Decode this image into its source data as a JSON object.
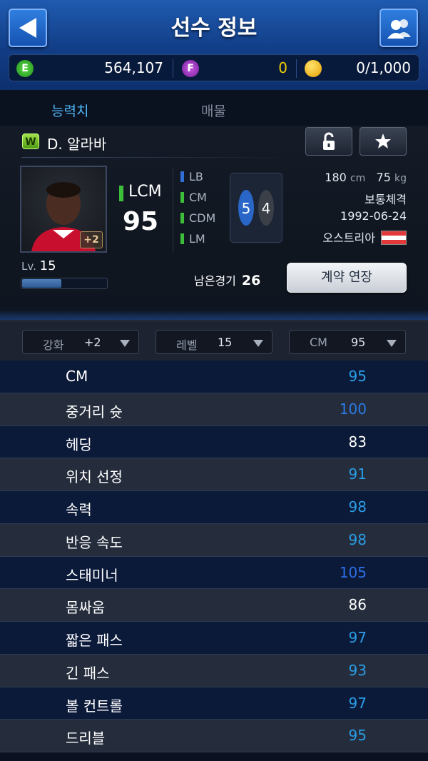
{
  "header": {
    "title": "선수 정보"
  },
  "currency": {
    "e_icon": "E",
    "e_value": "564,107",
    "f_icon": "F",
    "f_value": "0",
    "gold_value": "0/1,000"
  },
  "tabs": [
    {
      "label": "능력치",
      "active": true
    },
    {
      "label": "매물",
      "active": false
    }
  ],
  "player": {
    "badge": "W",
    "name": "D. 알라바",
    "main_position": "LCM",
    "overall": "95",
    "upgrade_badge": "+2",
    "level_label": "Lv.",
    "level": "15",
    "level_progress": 0.47,
    "positions": [
      {
        "label": "LB",
        "color": "#2f6fd6"
      },
      {
        "label": "CM",
        "color": "#3ebd3a"
      },
      {
        "label": "CDM",
        "color": "#3ebd3a"
      },
      {
        "label": "LM",
        "color": "#3ebd3a"
      }
    ],
    "foot_left": "5",
    "foot_right": "4",
    "height": "180",
    "height_unit": "cm",
    "weight": "75",
    "weight_unit": "kg",
    "body_type": "보통체격",
    "birthdate": "1992-06-24",
    "nationality": "오스트리아",
    "remaining_label": "남은경기",
    "remaining": "26",
    "extend_label": "계약 연장"
  },
  "filters": [
    {
      "label": "강화",
      "value": "+2"
    },
    {
      "label": "레벨",
      "value": "15"
    },
    {
      "label": "CM",
      "value": "95"
    }
  ],
  "stats": [
    {
      "name": "CM",
      "value": "95",
      "color": "#2a9ee8"
    },
    {
      "name": "중거리 슛",
      "value": "100",
      "color": "#2a7be8"
    },
    {
      "name": "헤딩",
      "value": "83",
      "color": "#ffffff"
    },
    {
      "name": "위치 선정",
      "value": "91",
      "color": "#2a9ee8"
    },
    {
      "name": "속력",
      "value": "98",
      "color": "#2a9ee8"
    },
    {
      "name": "반응 속도",
      "value": "98",
      "color": "#2a9ee8"
    },
    {
      "name": "스태미너",
      "value": "105",
      "color": "#2a6fe8"
    },
    {
      "name": "몸싸움",
      "value": "86",
      "color": "#ffffff"
    },
    {
      "name": "짧은 패스",
      "value": "97",
      "color": "#2a9ee8"
    },
    {
      "name": "긴 패스",
      "value": "93",
      "color": "#2a9ee8"
    },
    {
      "name": "볼 컨트롤",
      "value": "97",
      "color": "#2a9ee8"
    },
    {
      "name": "드리블",
      "value": "95",
      "color": "#2a9ee8"
    }
  ]
}
